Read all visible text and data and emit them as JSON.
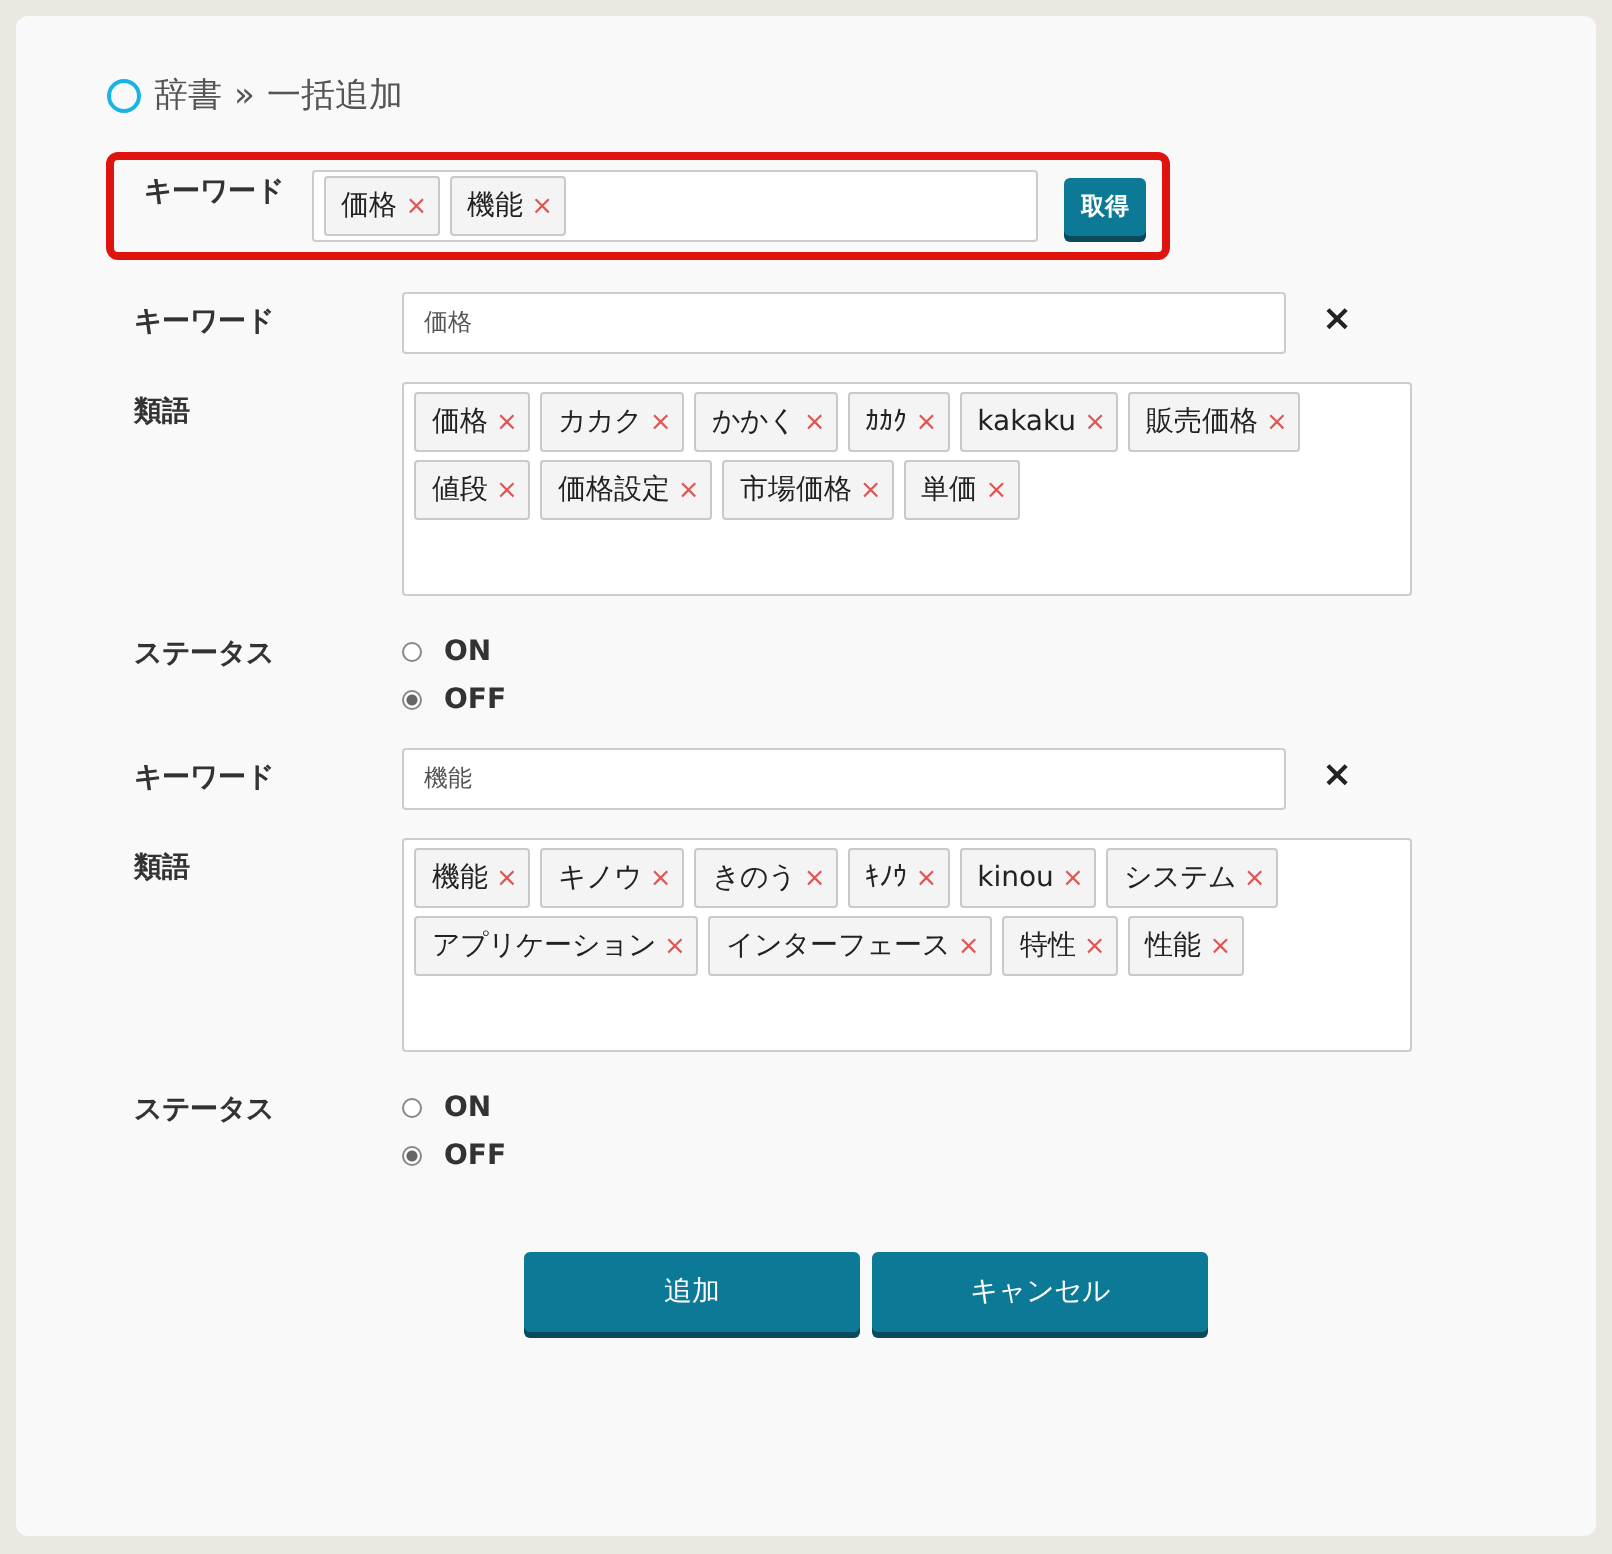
{
  "breadcrumb": {
    "parent": "辞書",
    "separator": "»",
    "current": "一括追加"
  },
  "fetch": {
    "label": "キーワード",
    "tags": [
      "価格",
      "機能"
    ],
    "button": "取得",
    "highlighted": true
  },
  "entries": [
    {
      "keyword_label": "キーワード",
      "keyword": "価格",
      "remove": "×",
      "synonyms_label": "類語",
      "synonyms": [
        "価格",
        "カカク",
        "かかく",
        "ｶｶｸ",
        "kakaku",
        "販売価格",
        "値段",
        "価格設定",
        "市場価格",
        "単価"
      ],
      "status_label": "ステータス",
      "options": [
        {
          "label": "ON",
          "selected": false
        },
        {
          "label": "OFF",
          "selected": true
        }
      ]
    },
    {
      "keyword_label": "キーワード",
      "keyword": "機能",
      "remove": "×",
      "synonyms_label": "類語",
      "synonyms": [
        "機能",
        "キノウ",
        "きのう",
        "ｷﾉｳ",
        "kinou",
        "システム",
        "アプリケーション",
        "インターフェース",
        "特性",
        "性能"
      ],
      "status_label": "ステータス",
      "options": [
        {
          "label": "ON",
          "selected": false
        },
        {
          "label": "OFF",
          "selected": true
        }
      ]
    }
  ],
  "tag_remove": "×",
  "buttons": [
    "追加",
    "キャンセル"
  ]
}
